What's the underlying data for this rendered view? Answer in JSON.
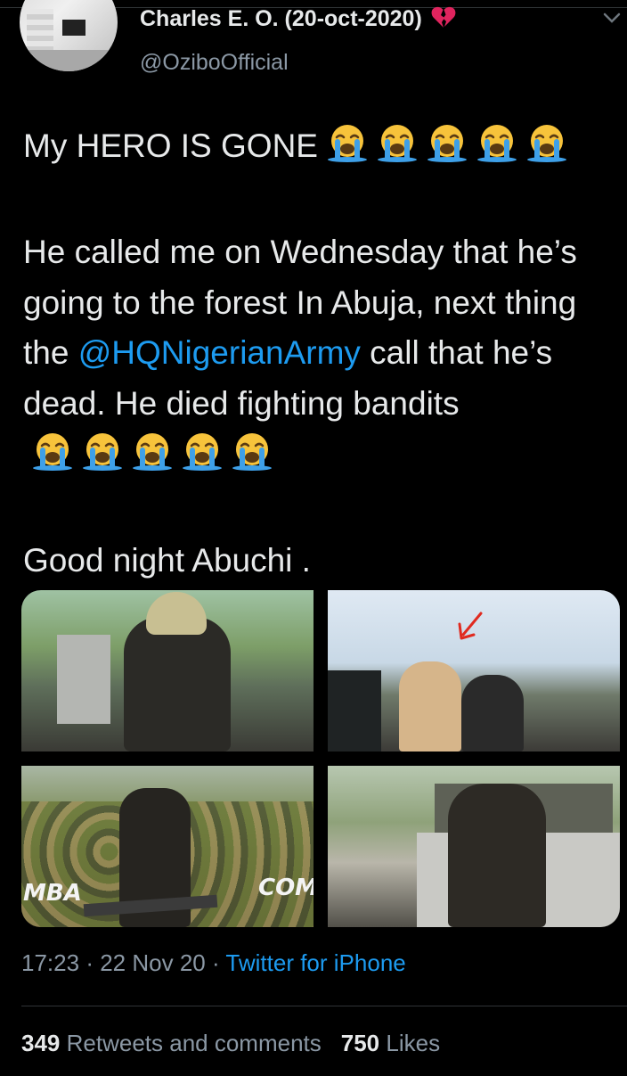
{
  "header": {
    "display_name": "Charles E. O. (20-oct-2020)",
    "handle": "@OziboOfficial",
    "name_icon": "broken-heart-icon",
    "menu_icon": "chevron-down-icon"
  },
  "tweet": {
    "line1": "My HERO IS GONE",
    "para2_before": "He called me on Wednesday that he’s going to the forest In Abuja, next thing the ",
    "mention": "@HQNigerianArmy",
    "para2_after": " call that he’s dead. He died fighting bandits",
    "line3": "Good night Abuchi .",
    "emoji_name": "loudly-crying-face-icon",
    "emoji_count": 5
  },
  "media": {
    "photos": [
      {
        "name": "photo-1"
      },
      {
        "name": "photo-2"
      },
      {
        "name": "photo-3",
        "text": "MBA",
        "text2": "COM"
      },
      {
        "name": "photo-4"
      }
    ]
  },
  "meta": {
    "time": "17:23",
    "dot": "·",
    "date": "22 Nov 20",
    "source": "Twitter for iPhone"
  },
  "stats": {
    "retweets_count": "349",
    "retweets_label": "Retweets and comments",
    "likes_count": "750",
    "likes_label": "Likes"
  },
  "colors": {
    "background": "#000000",
    "text": "#e7e9ea",
    "secondary": "#8b98a5",
    "link": "#1d9bf0",
    "heart": "#e0245e"
  }
}
